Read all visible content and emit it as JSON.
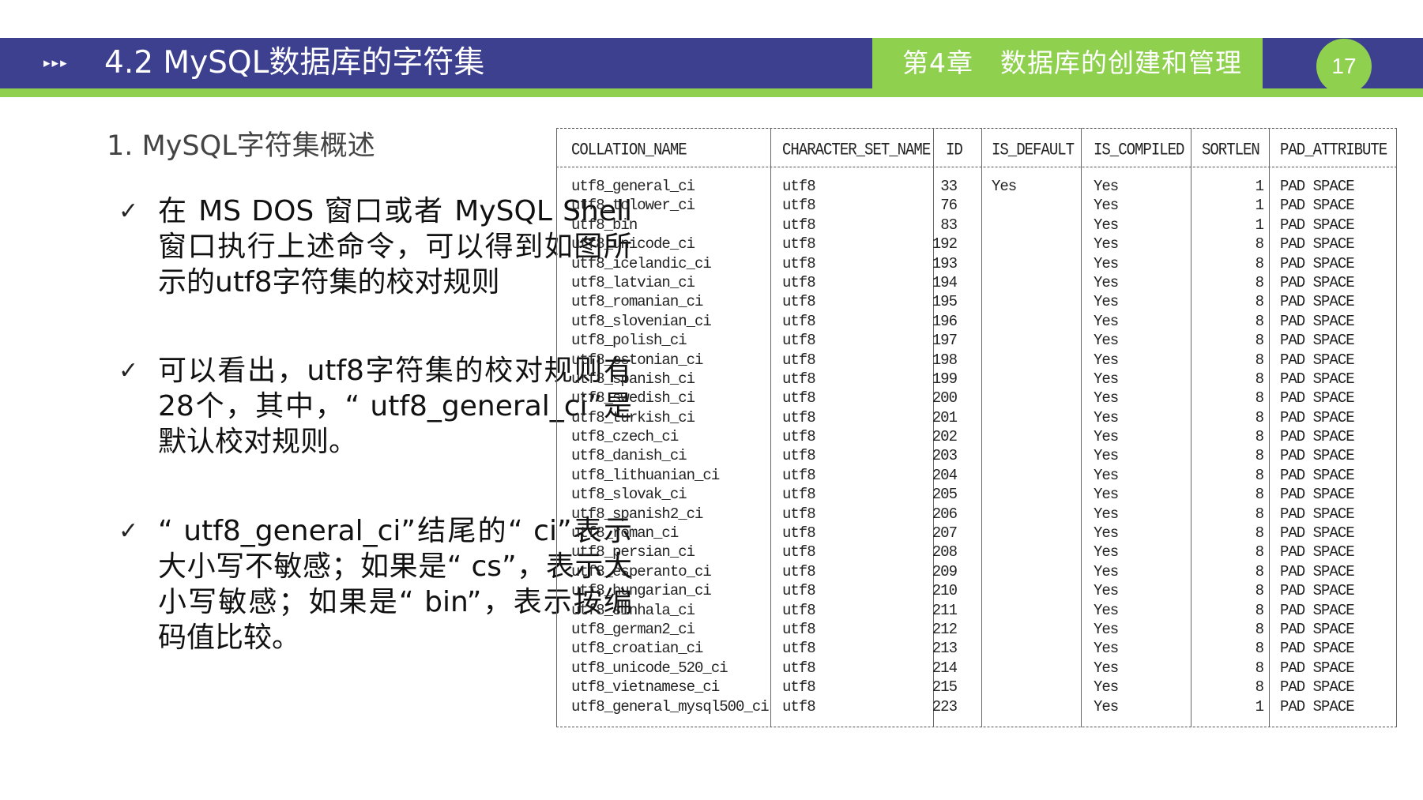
{
  "header": {
    "arrows": "▸▸▸",
    "title": "4.2 MySQL数据库的字符集",
    "chapter": "第4章　数据库的创建和管理",
    "page_number": "17",
    "colors": {
      "primary": "#3d3f8f",
      "accent": "#8fd14f"
    }
  },
  "section": {
    "heading": "1. MySQL字符集概述"
  },
  "bullets": [
    {
      "icon": "check-icon",
      "mark": "✓",
      "text": "在 MS DOS 窗口或者 MySQL Shell窗口执行上述命令，可以得到如图所示的utf8字符集的校对规则"
    },
    {
      "icon": "check-icon",
      "mark": "✓",
      "text": "可以看出，utf8字符集的校对规则有28个，其中，“ utf8_general_ci”是默认校对规则。"
    },
    {
      "icon": "check-icon",
      "mark": "✓",
      "text": "“ utf8_general_ci”结尾的“ ci”表示大小写不敏感；如果是“ cs”，表示大小写敏感；如果是“ bin”，表示按编码值比较。"
    }
  ],
  "table": {
    "columns": [
      "COLLATION_NAME",
      "CHARACTER_SET_NAME",
      "ID",
      "IS_DEFAULT",
      "IS_COMPILED",
      "SORTLEN",
      "PAD_ATTRIBUTE"
    ],
    "rows": [
      [
        "utf8_general_ci",
        "utf8",
        "33",
        "Yes",
        "Yes",
        "1",
        "PAD SPACE"
      ],
      [
        "utf8_tolower_ci",
        "utf8",
        "76",
        "",
        "Yes",
        "1",
        "PAD SPACE"
      ],
      [
        "utf8_bin",
        "utf8",
        "83",
        "",
        "Yes",
        "1",
        "PAD SPACE"
      ],
      [
        "utf8_unicode_ci",
        "utf8",
        "192",
        "",
        "Yes",
        "8",
        "PAD SPACE"
      ],
      [
        "utf8_icelandic_ci",
        "utf8",
        "193",
        "",
        "Yes",
        "8",
        "PAD SPACE"
      ],
      [
        "utf8_latvian_ci",
        "utf8",
        "194",
        "",
        "Yes",
        "8",
        "PAD SPACE"
      ],
      [
        "utf8_romanian_ci",
        "utf8",
        "195",
        "",
        "Yes",
        "8",
        "PAD SPACE"
      ],
      [
        "utf8_slovenian_ci",
        "utf8",
        "196",
        "",
        "Yes",
        "8",
        "PAD SPACE"
      ],
      [
        "utf8_polish_ci",
        "utf8",
        "197",
        "",
        "Yes",
        "8",
        "PAD SPACE"
      ],
      [
        "utf8_estonian_ci",
        "utf8",
        "198",
        "",
        "Yes",
        "8",
        "PAD SPACE"
      ],
      [
        "utf8_spanish_ci",
        "utf8",
        "199",
        "",
        "Yes",
        "8",
        "PAD SPACE"
      ],
      [
        "utf8_swedish_ci",
        "utf8",
        "200",
        "",
        "Yes",
        "8",
        "PAD SPACE"
      ],
      [
        "utf8_turkish_ci",
        "utf8",
        "201",
        "",
        "Yes",
        "8",
        "PAD SPACE"
      ],
      [
        "utf8_czech_ci",
        "utf8",
        "202",
        "",
        "Yes",
        "8",
        "PAD SPACE"
      ],
      [
        "utf8_danish_ci",
        "utf8",
        "203",
        "",
        "Yes",
        "8",
        "PAD SPACE"
      ],
      [
        "utf8_lithuanian_ci",
        "utf8",
        "204",
        "",
        "Yes",
        "8",
        "PAD SPACE"
      ],
      [
        "utf8_slovak_ci",
        "utf8",
        "205",
        "",
        "Yes",
        "8",
        "PAD SPACE"
      ],
      [
        "utf8_spanish2_ci",
        "utf8",
        "206",
        "",
        "Yes",
        "8",
        "PAD SPACE"
      ],
      [
        "utf8_roman_ci",
        "utf8",
        "207",
        "",
        "Yes",
        "8",
        "PAD SPACE"
      ],
      [
        "utf8_persian_ci",
        "utf8",
        "208",
        "",
        "Yes",
        "8",
        "PAD SPACE"
      ],
      [
        "utf8_esperanto_ci",
        "utf8",
        "209",
        "",
        "Yes",
        "8",
        "PAD SPACE"
      ],
      [
        "utf8_hungarian_ci",
        "utf8",
        "210",
        "",
        "Yes",
        "8",
        "PAD SPACE"
      ],
      [
        "utf8_sinhala_ci",
        "utf8",
        "211",
        "",
        "Yes",
        "8",
        "PAD SPACE"
      ],
      [
        "utf8_german2_ci",
        "utf8",
        "212",
        "",
        "Yes",
        "8",
        "PAD SPACE"
      ],
      [
        "utf8_croatian_ci",
        "utf8",
        "213",
        "",
        "Yes",
        "8",
        "PAD SPACE"
      ],
      [
        "utf8_unicode_520_ci",
        "utf8",
        "214",
        "",
        "Yes",
        "8",
        "PAD SPACE"
      ],
      [
        "utf8_vietnamese_ci",
        "utf8",
        "215",
        "",
        "Yes",
        "8",
        "PAD SPACE"
      ],
      [
        "utf8_general_mysql500_ci",
        "utf8",
        "223",
        "",
        "Yes",
        "1",
        "PAD SPACE"
      ]
    ]
  }
}
